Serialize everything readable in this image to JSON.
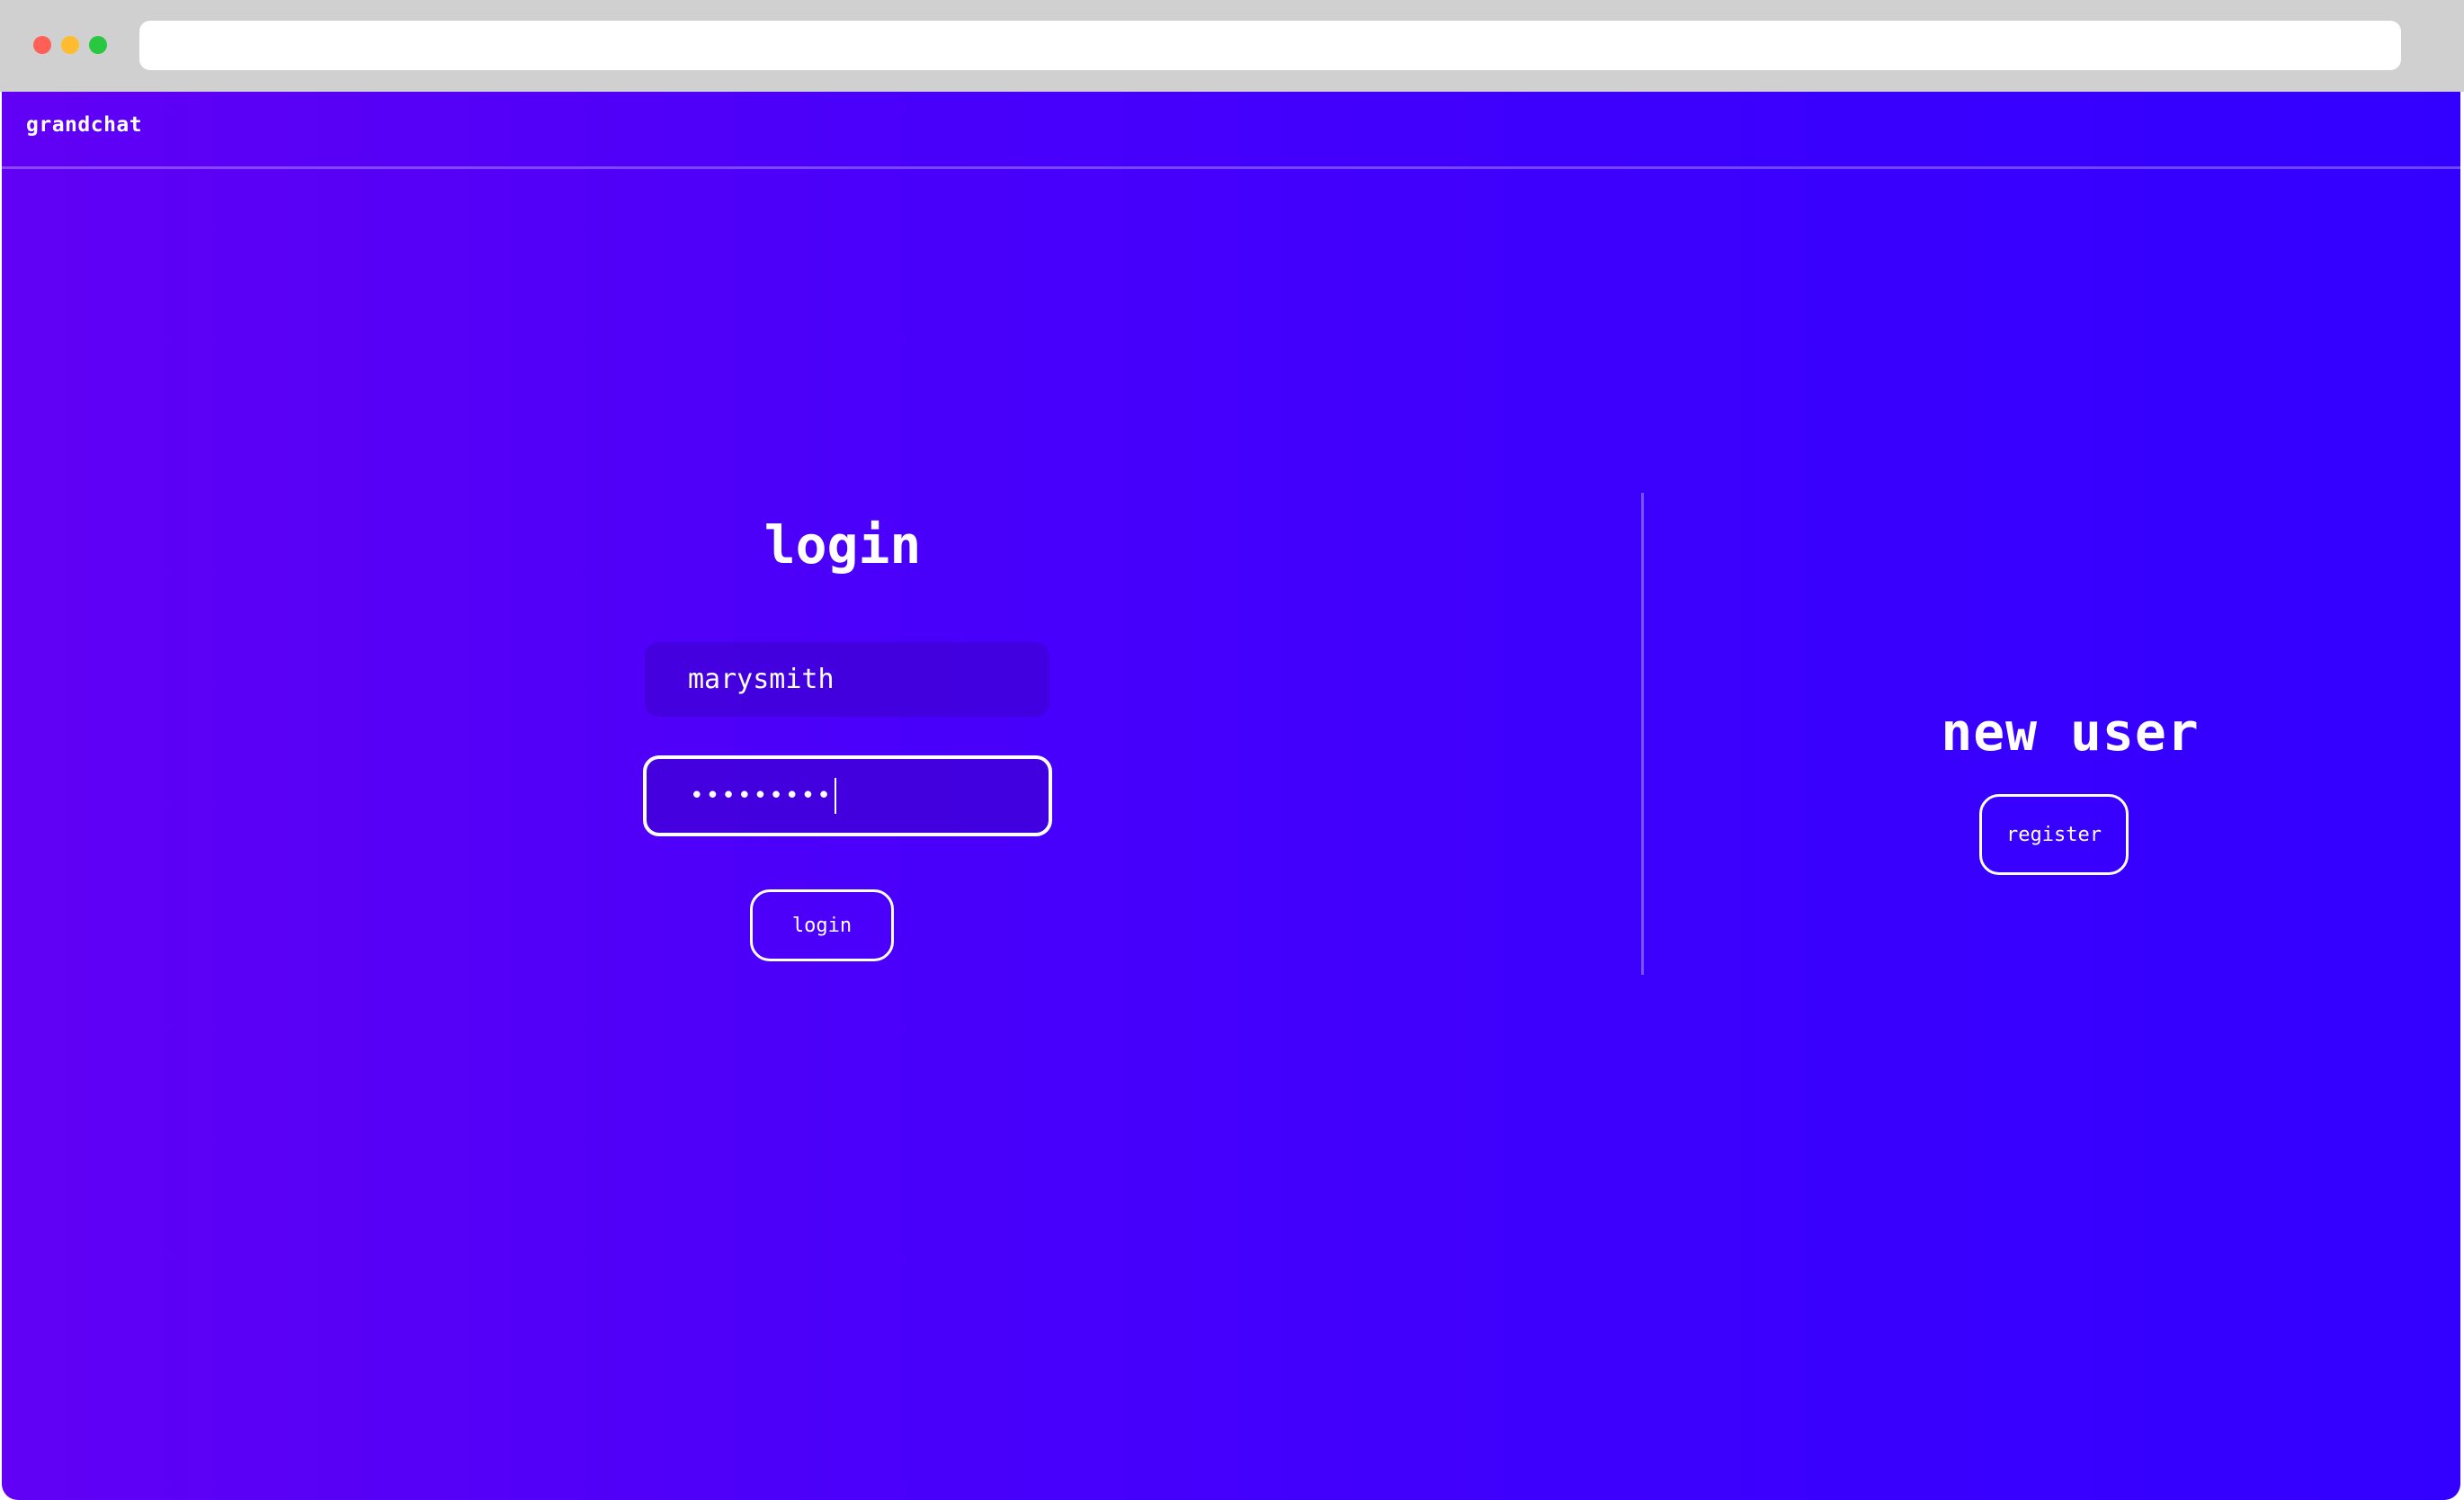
{
  "app": {
    "brand": "grandchat"
  },
  "login": {
    "title": "login",
    "username_value": "marysmith",
    "password_masked": "•••••••••",
    "submit_label": "login"
  },
  "register": {
    "title": "new user",
    "button_label": "register"
  },
  "colors": {
    "gradient_start": "#6100f4",
    "gradient_end": "#3300ff",
    "text": "#ffffff"
  }
}
